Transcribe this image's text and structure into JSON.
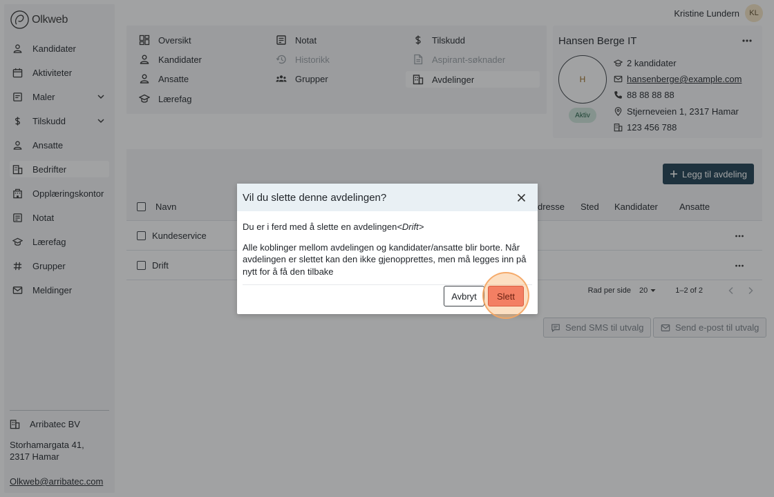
{
  "brand": {
    "name": "Olkweb"
  },
  "user": {
    "name": "Kristine Lundern",
    "initials": "KL"
  },
  "sidebar": {
    "items": [
      {
        "label": "Kandidater",
        "icon": "person-icon"
      },
      {
        "label": "Aktiviteter",
        "icon": "calendar-icon"
      },
      {
        "label": "Maler",
        "icon": "document-icon",
        "expandable": true
      },
      {
        "label": "Tilskudd",
        "icon": "dollar-icon",
        "expandable": true
      },
      {
        "label": "Ansatte",
        "icon": "person-icon"
      },
      {
        "label": "Bedrifter",
        "icon": "building-icon",
        "active": true
      },
      {
        "label": "Opplæringskontor",
        "icon": "office-icon"
      },
      {
        "label": "Notat",
        "icon": "note-icon"
      },
      {
        "label": "Lærefag",
        "icon": "graduation-cap-icon"
      },
      {
        "label": "Grupper",
        "icon": "hash-icon"
      },
      {
        "label": "Meldinger",
        "icon": "mail-icon"
      }
    ],
    "company": {
      "name": "Arribatec BV",
      "address": "Storhamargata 41, 2317 Hamar",
      "email": "Olkweb@arribatec.com"
    }
  },
  "tabs": [
    {
      "label": "Oversikt",
      "icon": "grid-icon"
    },
    {
      "label": "Kandidater",
      "icon": "person-icon"
    },
    {
      "label": "Ansatte",
      "icon": "person-icon"
    },
    {
      "label": "Lærefag",
      "icon": "graduation-cap-icon"
    },
    {
      "label": "Notat",
      "icon": "note-icon"
    },
    {
      "label": "Historikk",
      "icon": "history-icon",
      "disabled": true
    },
    {
      "label": "Grupper",
      "icon": "group-icon"
    },
    {
      "label": "Tilskudd",
      "icon": "dollar-icon"
    },
    {
      "label": "Aspirant-søknader",
      "icon": "file-icon",
      "disabled": true
    },
    {
      "label": "Avdelinger",
      "icon": "building-icon",
      "active": true
    }
  ],
  "company_card": {
    "title": "Hansen Berge IT",
    "avatar_letter": "H",
    "status": "Aktiv",
    "candidates": "2 kandidater",
    "email": "hansenberge@example.com",
    "phone": "88 88 88 88",
    "address": "Stjerneveien 1, 2317 Hamar",
    "org_number": "123 456 788"
  },
  "departments": {
    "add_button": "Legg til avdeling",
    "columns": {
      "name": "Navn",
      "address": "dresse",
      "place": "Sted",
      "candidates": "Kandidater",
      "employees": "Ansatte"
    },
    "rows": [
      {
        "name": "Kundeservice"
      },
      {
        "name": "Drift"
      }
    ],
    "pagination": {
      "rows_per_page_label": "Rad per side",
      "rows_per_page": "20",
      "range": "1–2 of 2"
    },
    "send_sms": "Send SMS til utvalg",
    "send_email": "Send e-post til utvalg"
  },
  "dialog": {
    "title": "Vil du slette denne avdelingen?",
    "intro": "Du er i ferd med å slette en avdelingen",
    "department": "<Drift>",
    "warning": "Alle koblinger mellom avdelingen og kandidater/ansatte blir borte. Når avdelingen er slettet kan den ikke gjenopprettes, men må legges inn på nytt for å få den tilbake",
    "cancel_label": "Avbryt",
    "delete_label": "Slett"
  },
  "colors": {
    "primary": "#1e3f51",
    "danger": "#f37f63",
    "highlight": "#f4a460",
    "status_active": "#cfe6db"
  }
}
